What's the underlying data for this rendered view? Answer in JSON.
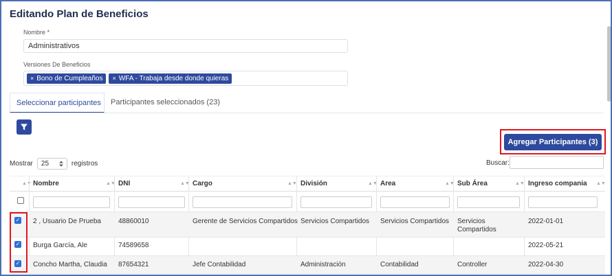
{
  "page": {
    "title": "Editando Plan de Beneficios"
  },
  "form": {
    "name_label": "Nombre *",
    "name_value": "Administrativos",
    "versions_label": "Versiones De Beneficios",
    "tags": [
      "Bono de Cumpleaños",
      "WFA - Trabaja desde donde quieras"
    ],
    "tag_remove_glyph": "×"
  },
  "tabs": [
    {
      "label": "Seleccionar participantes",
      "active": true
    },
    {
      "label": "Participantes seleccionados (23)",
      "active": false
    }
  ],
  "actions": {
    "add_participants": "Agregar Participantes (3)"
  },
  "table_controls": {
    "show_prefix": "Mostrar",
    "page_size": "25",
    "show_suffix": "registros",
    "search_label": "Buscar:"
  },
  "table": {
    "columns": [
      "Nombre",
      "DNI",
      "Cargo",
      "División",
      "Area",
      "Sub Área",
      "Ingreso compania"
    ],
    "sort_glyph": "▲▼",
    "rows": [
      {
        "checked": true,
        "cells": [
          "2 , Usuario De Prueba",
          "48860010",
          "Gerente de Servicios Compartidos",
          "Servicios Compartidos",
          "Servicios Compartidos",
          "Servicios Compartidos",
          "2022-01-01"
        ]
      },
      {
        "checked": true,
        "cells": [
          "Burga García, Ale",
          "74589658",
          "",
          "",
          "",
          "",
          "2022-05-21"
        ]
      },
      {
        "checked": true,
        "cells": [
          "Concho Martha, Claudia",
          "87654321",
          "Jefe Contabilidad",
          "Administración",
          "Contabilidad",
          "Controller",
          "2022-04-30"
        ]
      }
    ]
  },
  "icons": {
    "filter": "filter-icon",
    "select_arrows": "select-arrows-icon"
  },
  "colors": {
    "primary": "#2e4a9e",
    "highlight": "#e0161f",
    "checkbox": "#2f6fd6"
  }
}
